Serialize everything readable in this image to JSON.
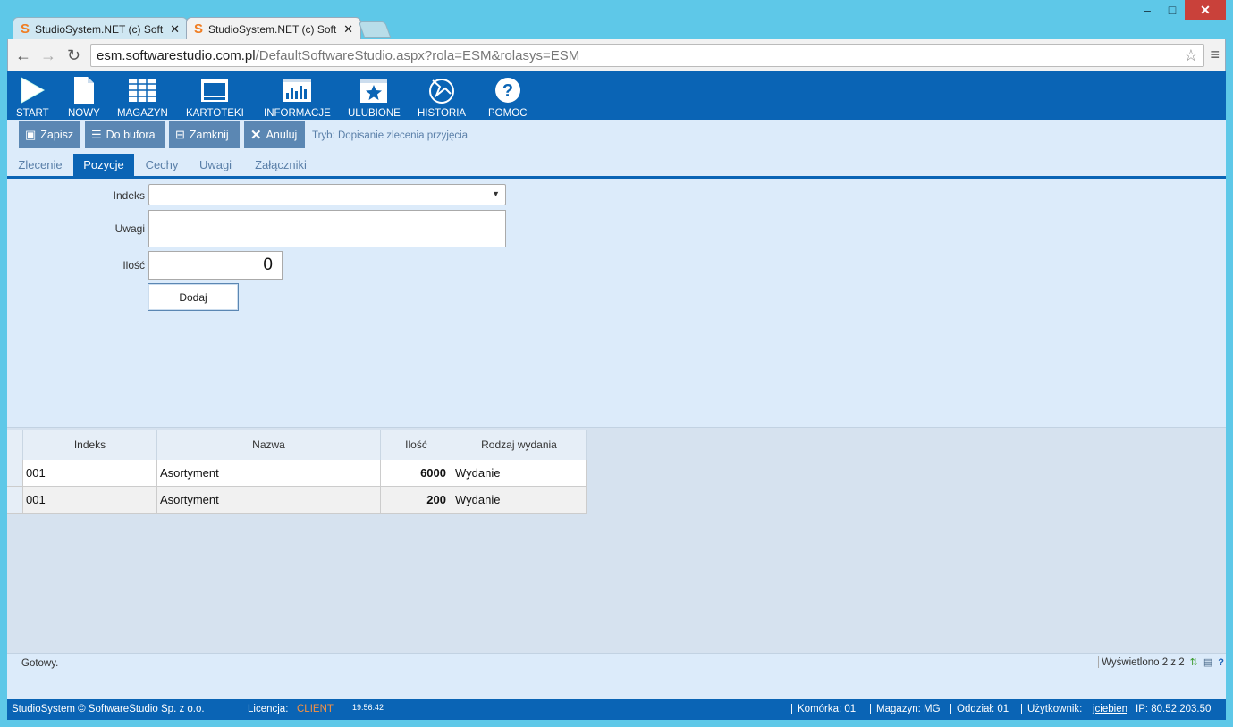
{
  "browser": {
    "tabs": [
      {
        "title": "StudioSystem.NET (c) Soft",
        "active": false
      },
      {
        "title": "StudioSystem.NET (c) Soft",
        "active": true
      }
    ],
    "url_host": "esm.softwarestudio.com.pl",
    "url_path": "/DefaultSoftwareStudio.aspx?rola=ESM&rolasys=ESM"
  },
  "topnav": {
    "items": [
      {
        "label": "START",
        "icon": "play-icon"
      },
      {
        "label": "NOWY",
        "icon": "document-icon"
      },
      {
        "label": "MAGAZYN",
        "icon": "grid-icon"
      },
      {
        "label": "KARTOTEKI",
        "icon": "window-icon"
      },
      {
        "label": "INFORMACJE",
        "icon": "chart-icon"
      },
      {
        "label": "ULUBIONE",
        "icon": "star-icon"
      },
      {
        "label": "HISTORIA",
        "icon": "history-icon"
      },
      {
        "label": "POMOC",
        "icon": "help-icon"
      }
    ]
  },
  "toolbar": {
    "save": "Zapisz",
    "buffer": "Do bufora",
    "close": "Zamknij",
    "cancel": "Anuluj",
    "mode": "Tryb: Dopisanie zlecenia przyjęcia"
  },
  "tabs": [
    "Zlecenie",
    "Pozycje",
    "Cechy",
    "Uwagi",
    "Załączniki"
  ],
  "active_tab": "Pozycje",
  "form": {
    "indeks_label": "Indeks",
    "uwagi_label": "Uwagi",
    "ilosc_label": "Ilość",
    "ilosc_value": "0",
    "add_button": "Dodaj"
  },
  "grid": {
    "columns": [
      "Indeks",
      "Nazwa",
      "Ilość",
      "Rodzaj wydania"
    ],
    "rows": [
      {
        "indeks": "001",
        "nazwa": "Asortyment",
        "ilosc": "6000",
        "rodzaj": "Wydanie"
      },
      {
        "indeks": "001",
        "nazwa": "Asortyment",
        "ilosc": "200",
        "rodzaj": "Wydanie"
      }
    ]
  },
  "status": {
    "text": "Gotowy.",
    "shown": "Wyświetlono 2 z 2"
  },
  "footer": {
    "company": "StudioSystem © SoftwareStudio Sp. z o.o.",
    "license_label": "Licencja:",
    "license_value": "CLIENT",
    "time": "19:56:42",
    "cell": "Komórka: 01",
    "warehouse": "Magazyn: MG",
    "branch": "Oddział: 01",
    "user_label": "Użytkownik:",
    "user": "jciebien",
    "ip": "IP: 80.52.203.50"
  }
}
